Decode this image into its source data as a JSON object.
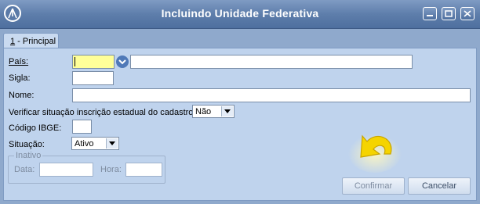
{
  "window": {
    "title": "Incluindo Unidade Federativa",
    "controls": [
      "minimize",
      "maximize",
      "close"
    ]
  },
  "tabs": [
    {
      "mnemonic": "1",
      "label": " - Principal",
      "active": true
    }
  ],
  "form": {
    "pais_label": "País:",
    "sigla_label": "Sigla:",
    "nome_label": "Nome:",
    "verificar_label": "Verificar situação inscrição estadual do cadastro:",
    "verificar_value": "Não",
    "ibge_label": "Código IBGE:",
    "situacao_label": "Situação:",
    "situacao_value": "Ativo",
    "pais_code_value": "",
    "pais_name_value": "",
    "sigla_value": "",
    "nome_value": "",
    "ibge_value": ""
  },
  "inativo": {
    "legend": "Inativo",
    "data_label": "Data:",
    "hora_label": "Hora:",
    "data_value": "",
    "hora_value": ""
  },
  "buttons": {
    "confirmar": "Confirmar",
    "cancelar": "Cancelar"
  },
  "colors": {
    "titlebar": "#5e7eab",
    "panel": "#bfd3ed",
    "required_field": "#ffff99",
    "hint_arrow": "#f5d400"
  },
  "icons": {
    "app_logo": "app-logo-icon",
    "lookup": "chevron-down-circle-icon",
    "hint": "curved-arrow-icon"
  }
}
